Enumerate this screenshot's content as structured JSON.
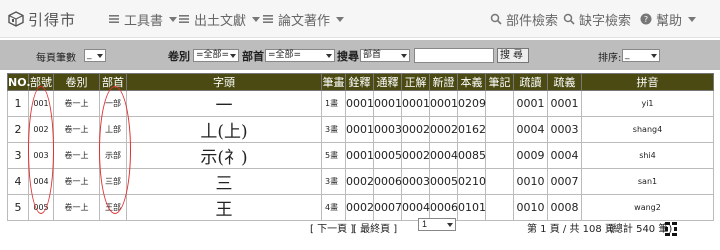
{
  "brand": {
    "name": "引得市"
  },
  "nav": {
    "tools": "工具書",
    "unearthed": "出土文獻",
    "papers": "論文著作",
    "radical_search": "部件檢索",
    "missing_char_search": "缺字檢索",
    "help": "幫助"
  },
  "toolbar": {
    "per_page_label": "每頁筆數",
    "per_page_value": "_",
    "volume_label": "卷別",
    "volume_value": "=全部=",
    "radical_label": "部首",
    "radical_value": "=全部=",
    "search_label": "搜尋",
    "search_field_value": "部首",
    "search_input_value": "",
    "search_button": "搜尋",
    "sort_label": "排序:",
    "sort_value": "_"
  },
  "table": {
    "headers": [
      "NO.",
      "部號",
      "卷別",
      "部首",
      "字頭",
      "筆畫",
      "銓釋",
      "通釋",
      "正解",
      "新證",
      "本義",
      "筆記",
      "疏讀",
      "疏義",
      "拼音"
    ],
    "rows": [
      {
        "no": "1",
        "bu_no": "001",
        "volume": "卷一上",
        "radical": "一部",
        "char": "一",
        "strokes": "1畫",
        "c1": "0001",
        "c2": "0001",
        "c3": "0001",
        "c4": "0001",
        "c5": "0209",
        "c6": "",
        "c7": "0001",
        "c8": "0001",
        "pinyin": "yi1"
      },
      {
        "no": "2",
        "bu_no": "002",
        "volume": "卷一上",
        "radical": "丄部",
        "char": "丄(上)",
        "strokes": "3畫",
        "c1": "0001",
        "c2": "0003",
        "c3": "0002",
        "c4": "0002",
        "c5": "0162",
        "c6": "",
        "c7": "0004",
        "c8": "0003",
        "pinyin": "shang4"
      },
      {
        "no": "3",
        "bu_no": "003",
        "volume": "卷一上",
        "radical": "示部",
        "char": "示(礻)",
        "strokes": "5畫",
        "c1": "0001",
        "c2": "0005",
        "c3": "0002",
        "c4": "0004",
        "c5": "0085",
        "c6": "",
        "c7": "0009",
        "c8": "0004",
        "pinyin": "shi4"
      },
      {
        "no": "4",
        "bu_no": "004",
        "volume": "卷一上",
        "radical": "三部",
        "char": "三",
        "strokes": "3畫",
        "c1": "0002",
        "c2": "0006",
        "c3": "0003",
        "c4": "0005",
        "c5": "0210",
        "c6": "",
        "c7": "0010",
        "c8": "0007",
        "pinyin": "san1"
      },
      {
        "no": "5",
        "bu_no": "005",
        "volume": "卷一上",
        "radical": "王部",
        "char": "王",
        "strokes": "4畫",
        "c1": "0002",
        "c2": "0007",
        "c3": "0004",
        "c4": "0006",
        "c5": "0101",
        "c6": "",
        "c7": "0010",
        "c8": "0008",
        "pinyin": "wang2"
      }
    ]
  },
  "pager": {
    "prev": "[ 下一頁 ]",
    "last": "[ 最終頁 ]",
    "page_value": "1",
    "page_info": "第 1 頁 / 共 108 頁",
    "total_info": "(總計 540 筆)"
  },
  "colors": {
    "header_bg": "#4a4a12",
    "toolbar_bg": "#bdbdbd",
    "highlight": "#e03030"
  }
}
